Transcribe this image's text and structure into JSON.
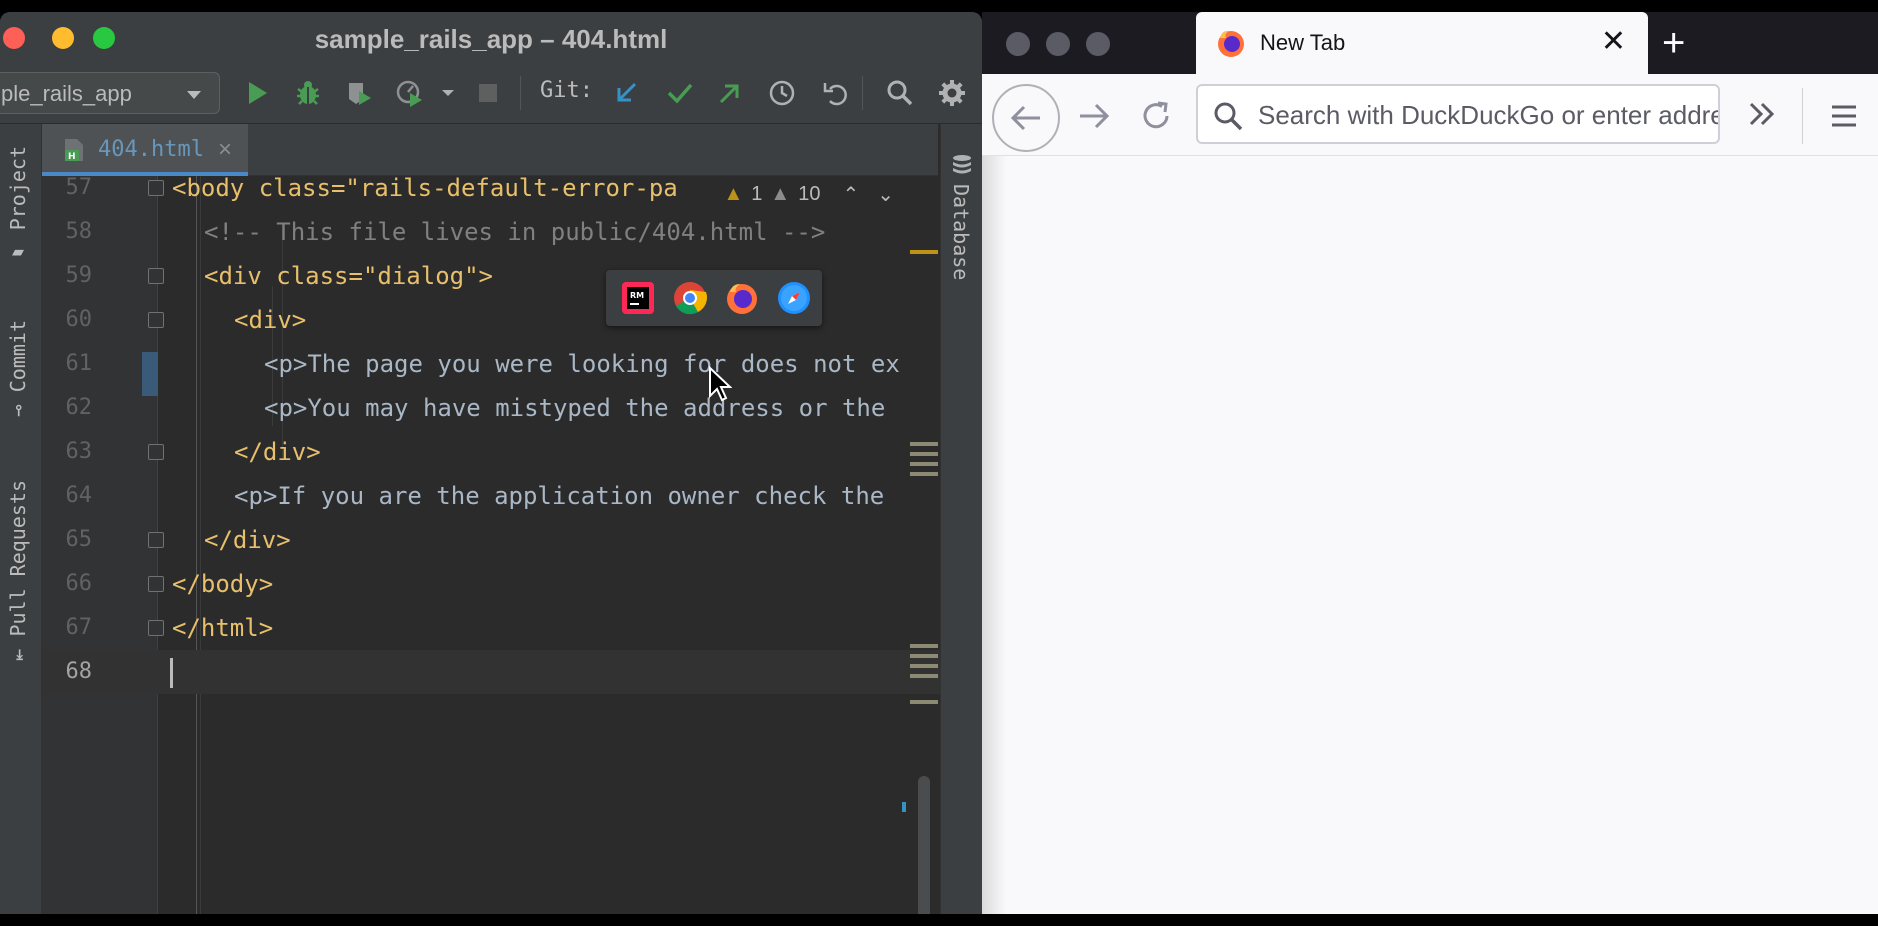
{
  "ide": {
    "window_title": "sample_rails_app – 404.html",
    "run_config": "ple_rails_app",
    "git_label": "Git:",
    "tab": {
      "filename": "404.html"
    },
    "left_tabs": {
      "project": "Project",
      "commit": "Commit",
      "pull_requests": "Pull Requests"
    },
    "right_tabs": {
      "database": "Database"
    },
    "inspections": {
      "warnings": "1",
      "weak_warnings": "10"
    },
    "lines": [
      {
        "num": "57",
        "code": "<body class=\"rails-default-error-pa"
      },
      {
        "num": "58",
        "code": "<!-- This file lives in public/404.html -->"
      },
      {
        "num": "59",
        "code": "<div class=\"dialog\">"
      },
      {
        "num": "60",
        "code": "<div>"
      },
      {
        "num": "61",
        "code": "<p>The page you were looking for does not ex"
      },
      {
        "num": "62",
        "code": "<p>You may have mistyped the address or the"
      },
      {
        "num": "63",
        "code": "</div>"
      },
      {
        "num": "64",
        "code": "<p>If you are the application owner check the"
      },
      {
        "num": "65",
        "code": "</div>"
      },
      {
        "num": "66",
        "code": "</body>"
      },
      {
        "num": "67",
        "code": "</html>"
      },
      {
        "num": "68",
        "code": ""
      }
    ],
    "accent_color": "#4a88c7"
  },
  "browser": {
    "tab_title": "New Tab",
    "url_placeholder": "Search with DuckDuckGo or enter address",
    "icons": [
      "back-icon",
      "forward-icon",
      "reload-icon",
      "search-icon",
      "overflow-icon",
      "menu-icon"
    ]
  }
}
